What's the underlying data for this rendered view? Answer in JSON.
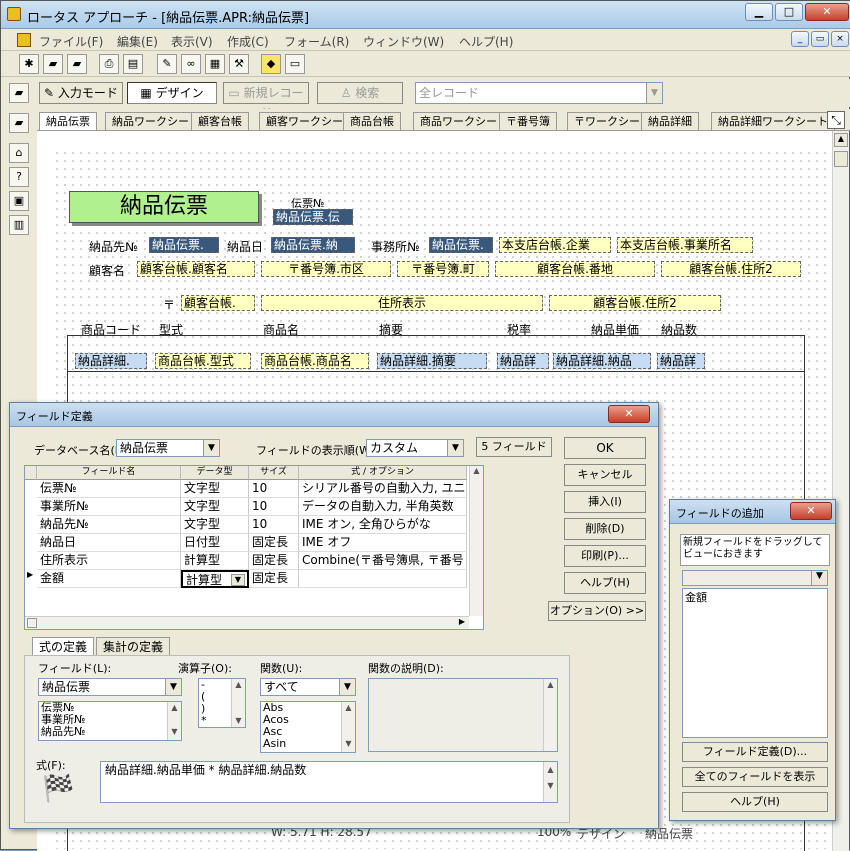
{
  "window": {
    "title": "ロータス アプローチ - [納品伝票.APR:納品伝票]"
  },
  "menu": [
    "ファイル(F)",
    "編集(E)",
    "表示(V)",
    "作成(C)",
    "フォーム(R)",
    "ウィンドウ(W)",
    "ヘルプ(H)"
  ],
  "toolbar2": {
    "input_mode": "入力モード",
    "design": "デザイン",
    "new_record": "新規レコード",
    "search": "検索",
    "records_combo": "全レコード"
  },
  "tabs": [
    "納品伝票",
    "納品ワークシート",
    "顧客台帳",
    "顧客ワークシート",
    "商品台帳",
    "商品ワークシート",
    "〒番号簿",
    "〒ワークシート",
    "納品詳細",
    "納品詳細ワークシート"
  ],
  "form": {
    "title": "納品伝票",
    "slip_no_label": "伝票№",
    "slip_no_field": "納品伝票.伝",
    "dest_label": "納品先№",
    "dest_field": "納品伝票.",
    "date_label": "納品日",
    "date_field": "納品伝票.納",
    "office_label": "事務所№",
    "office_field": "納品伝票.",
    "branch_company": "本支店台帳.企業",
    "branch_office": "本支店台帳.事業所名",
    "customer_label": "顧客名",
    "customer_field": "顧客台帳.顧客名",
    "pref_field": "〒番号簿.市区",
    "town_field": "〒番号簿.町",
    "banchi_field": "顧客台帳.番地",
    "addr2_field": "顧客台帳.住所2",
    "zip_label": "〒",
    "zip_field": "顧客台帳.",
    "address_field": "住所表示",
    "addr2b_field": "顧客台帳.住所2",
    "col_headers": [
      "商品コード",
      "型式",
      "商品名",
      "摘要",
      "税率",
      "納品単価",
      "納品数"
    ],
    "row_fields": [
      "納品詳細.",
      "商品台帳.型式",
      "商品台帳.商品名",
      "納品詳細.摘要",
      "納品詳",
      "納品詳細.納品",
      "納品詳"
    ]
  },
  "dialog": {
    "title": "フィールド定義",
    "db_label": "データベース名(B):",
    "db_value": "納品伝票",
    "order_label": "フィールドの表示順(W):",
    "order_value": "カスタム",
    "field_count": "5 フィールド",
    "grid_headers": [
      "フィールド名",
      "データ型",
      "サイズ",
      "式 / オプション"
    ],
    "rows": [
      [
        "伝票№",
        "文字型",
        "10",
        "シリアル番号の自動入力, ユニーク"
      ],
      [
        "事業所№",
        "文字型",
        "10",
        "データの自動入力, 半角英数"
      ],
      [
        "納品先№",
        "文字型",
        "10",
        "IME オン, 全角ひらがな"
      ],
      [
        "納品日",
        "日付型",
        "固定長",
        "IME オフ"
      ],
      [
        "住所表示",
        "計算型",
        "固定長",
        "Combine(〒番号簿県, 〒番号"
      ],
      [
        "金額",
        "計算型",
        "固定長",
        ""
      ]
    ],
    "buttons": [
      "OK",
      "キャンセル",
      "挿入(I)",
      "削除(D)",
      "印刷(P)...",
      "ヘルプ(H)"
    ],
    "options_button": "オプション(O) >>",
    "subtabs": [
      "式の定義",
      "集計の定義"
    ],
    "field_label": "フィールド(L):",
    "field_combo": "納品伝票",
    "field_list": [
      "伝票№",
      "事業所№",
      "納品先№"
    ],
    "operator_label": "演算子(O):",
    "operators": [
      "-",
      "(",
      ")",
      "*"
    ],
    "function_label": "関数(U):",
    "function_combo": "すべて",
    "functions": [
      "Abs",
      "Acos",
      "Asc",
      "Asin"
    ],
    "func_desc_label": "関数の説明(D):",
    "formula_label": "式(F):",
    "formula_value": "納品詳細.納品単価 * 納品詳細.納品数"
  },
  "addfield": {
    "title": "フィールドの追加",
    "help_text": "新規フィールドをドラッグしてビューにおきます",
    "list_item": "金額",
    "btn_define": "フィールド定義(D)...",
    "btn_showall": "全てのフィールドを表示",
    "btn_help": "ヘルプ(H)"
  },
  "status": {
    "coords": "W: 5.71  H: 28.57",
    "zoom": "100%",
    "mode": "デザイン",
    "form": "納品伝票"
  }
}
